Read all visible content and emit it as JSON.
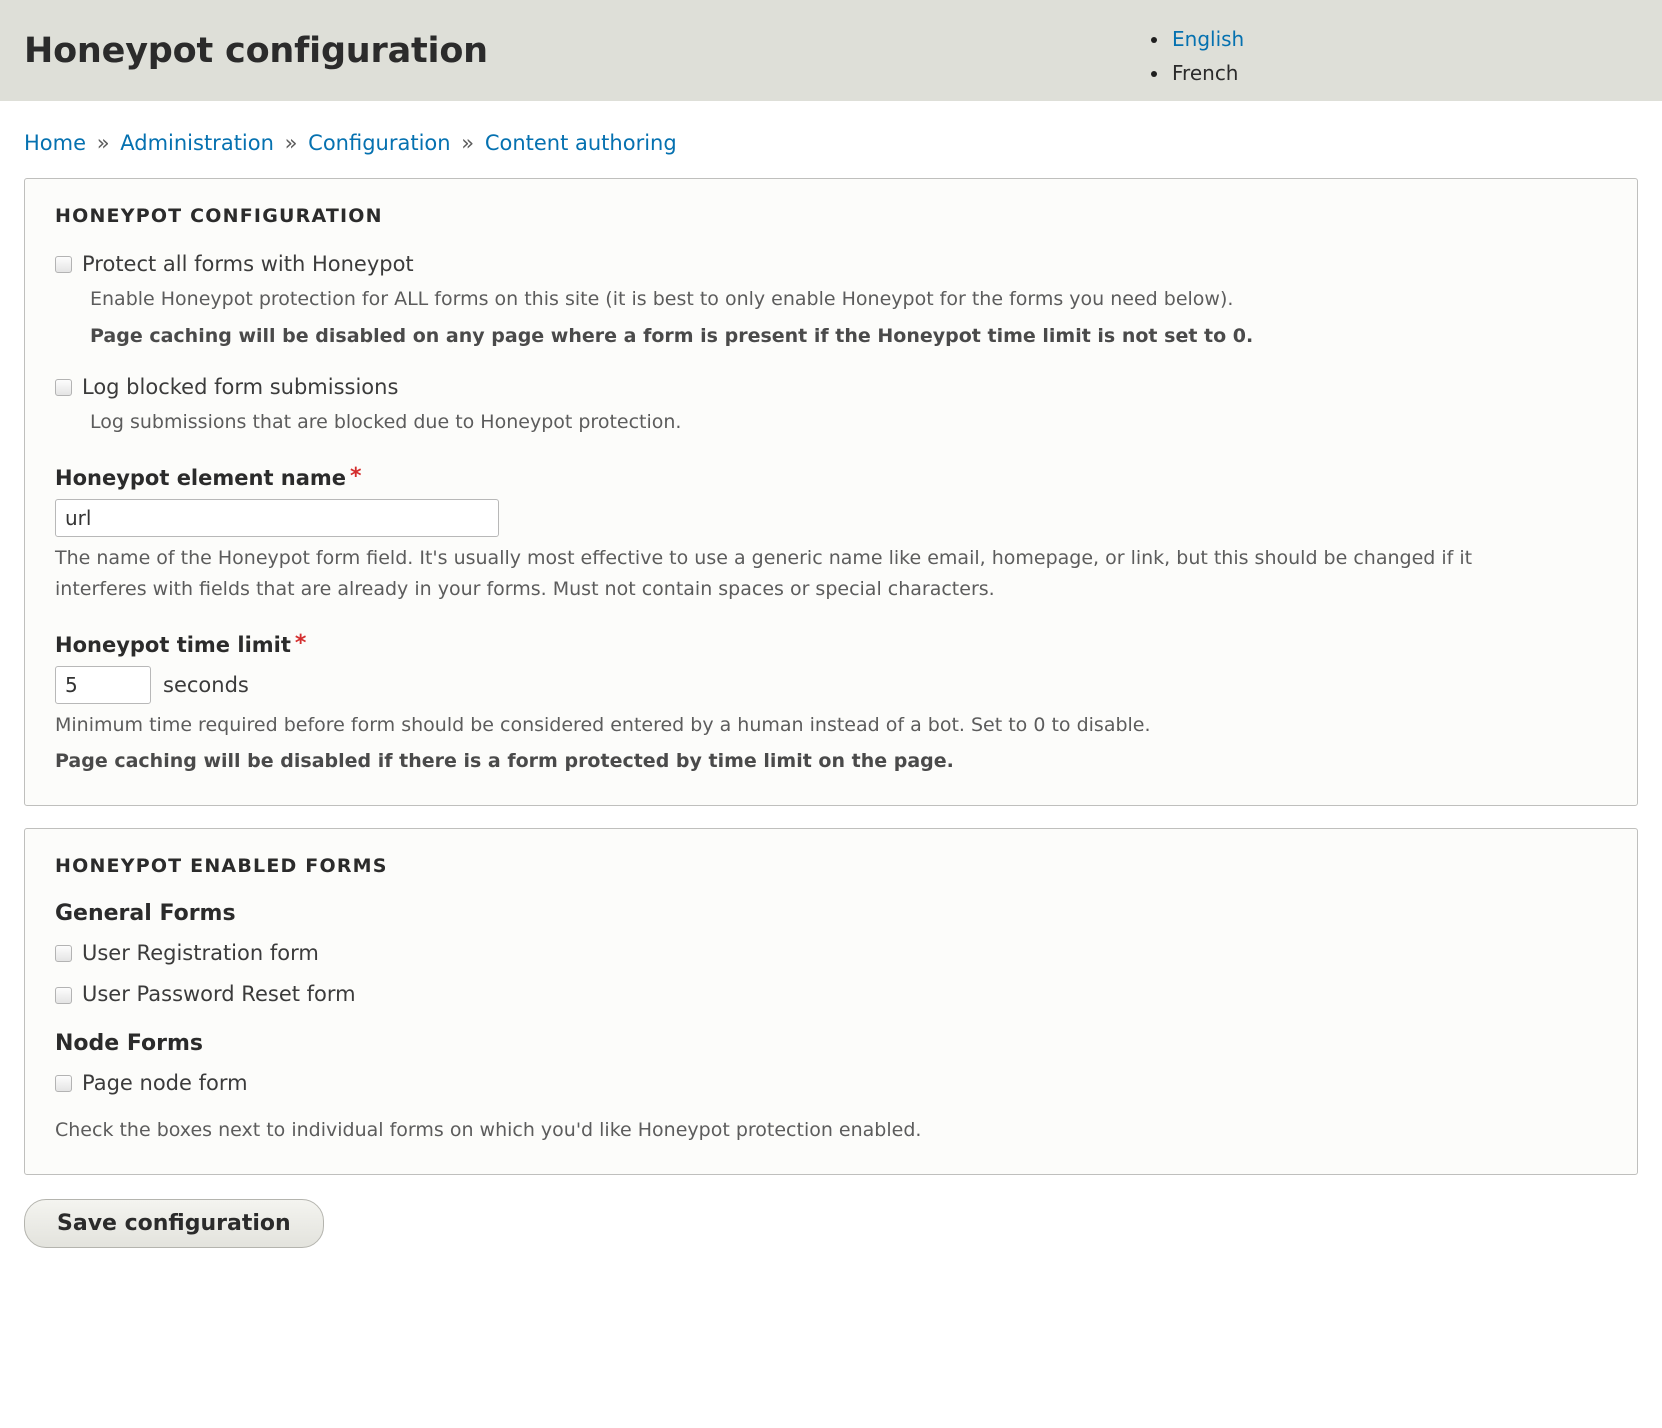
{
  "header": {
    "title": "Honeypot configuration",
    "languages": [
      {
        "label": "English",
        "active": true
      },
      {
        "label": "French",
        "active": false
      }
    ]
  },
  "breadcrumb": {
    "separator": "»",
    "items": [
      "Home",
      "Administration",
      "Configuration",
      "Content authoring"
    ]
  },
  "config_fieldset": {
    "legend": "HONEYPOT CONFIGURATION",
    "protect_all": {
      "label": "Protect all forms with Honeypot",
      "checked": false,
      "description": "Enable Honeypot protection for ALL forms on this site (it is best to only enable Honeypot for the forms you need below).",
      "warning": "Page caching will be disabled on any page where a form is present if the Honeypot time limit is not set to 0."
    },
    "log_blocked": {
      "label": "Log blocked form submissions",
      "checked": false,
      "description": "Log submissions that are blocked due to Honeypot protection."
    },
    "element_name": {
      "label": "Honeypot element name",
      "required_mark": "*",
      "value": "url",
      "description": "The name of the Honeypot form field. It's usually most effective to use a generic name like email, homepage, or link, but this should be changed if it interferes with fields that are already in your forms. Must not contain spaces or special characters."
    },
    "time_limit": {
      "label": "Honeypot time limit",
      "required_mark": "*",
      "value": "5",
      "suffix": "seconds",
      "description": "Minimum time required before form should be considered entered by a human instead of a bot. Set to 0 to disable.",
      "warning": "Page caching will be disabled if there is a form protected by time limit on the page."
    }
  },
  "forms_fieldset": {
    "legend": "HONEYPOT ENABLED FORMS",
    "groups": [
      {
        "heading": "General Forms",
        "items": [
          {
            "label": "User Registration form",
            "checked": false
          },
          {
            "label": "User Password Reset form",
            "checked": false
          }
        ]
      },
      {
        "heading": "Node Forms",
        "items": [
          {
            "label": "Page node form",
            "checked": false
          }
        ]
      }
    ],
    "description": "Check the boxes next to individual forms on which you'd like Honeypot protection enabled."
  },
  "actions": {
    "save_label": "Save configuration"
  },
  "colors": {
    "header_bg": "#dedfd8",
    "link": "#0571b0",
    "required": "#d42e2e",
    "fieldset_bg": "#fcfcfa",
    "fieldset_border": "#bfbfbd"
  }
}
